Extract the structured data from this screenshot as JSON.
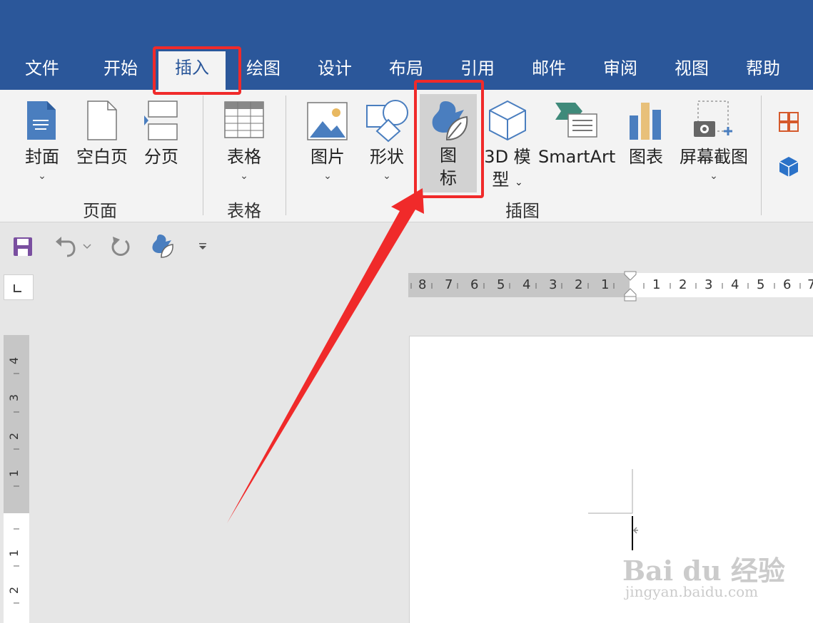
{
  "tabs": [
    "文件",
    "开始",
    "插入",
    "绘图",
    "设计",
    "布局",
    "引用",
    "邮件",
    "审阅",
    "视图",
    "帮助"
  ],
  "active_tab": "插入",
  "groups": {
    "pages": {
      "label": "页面",
      "cover": "封面",
      "blank": "空白页",
      "page_break": "分页"
    },
    "tables": {
      "label": "表格",
      "table": "表格"
    },
    "illustrations": {
      "label": "插图",
      "picture": "图片",
      "shapes": "形状",
      "icons_1": "图",
      "icons_2": "标",
      "model_1": "3D 模",
      "model_2": "型",
      "smartart": "SmartArt",
      "chart": "图表",
      "screenshot": "屏幕截图"
    }
  },
  "chevron": "⌄",
  "ruler": {
    "left_numbers": [
      "8",
      "7",
      "6",
      "5",
      "4",
      "3",
      "2",
      "1"
    ],
    "right_numbers": [
      "1",
      "2",
      "3",
      "4",
      "5",
      "6",
      "7"
    ],
    "vertical_numbers": [
      "4",
      "3",
      "2",
      "1",
      "1",
      "2"
    ]
  },
  "watermark": {
    "brand": "Bai du 经验",
    "url": "jingyan.baidu.com"
  },
  "colors": {
    "titlebar": "#2b579a",
    "ribbon": "#f3f3f3",
    "highlight": "#f02a2a",
    "icon_blue": "#4a7ebf"
  }
}
